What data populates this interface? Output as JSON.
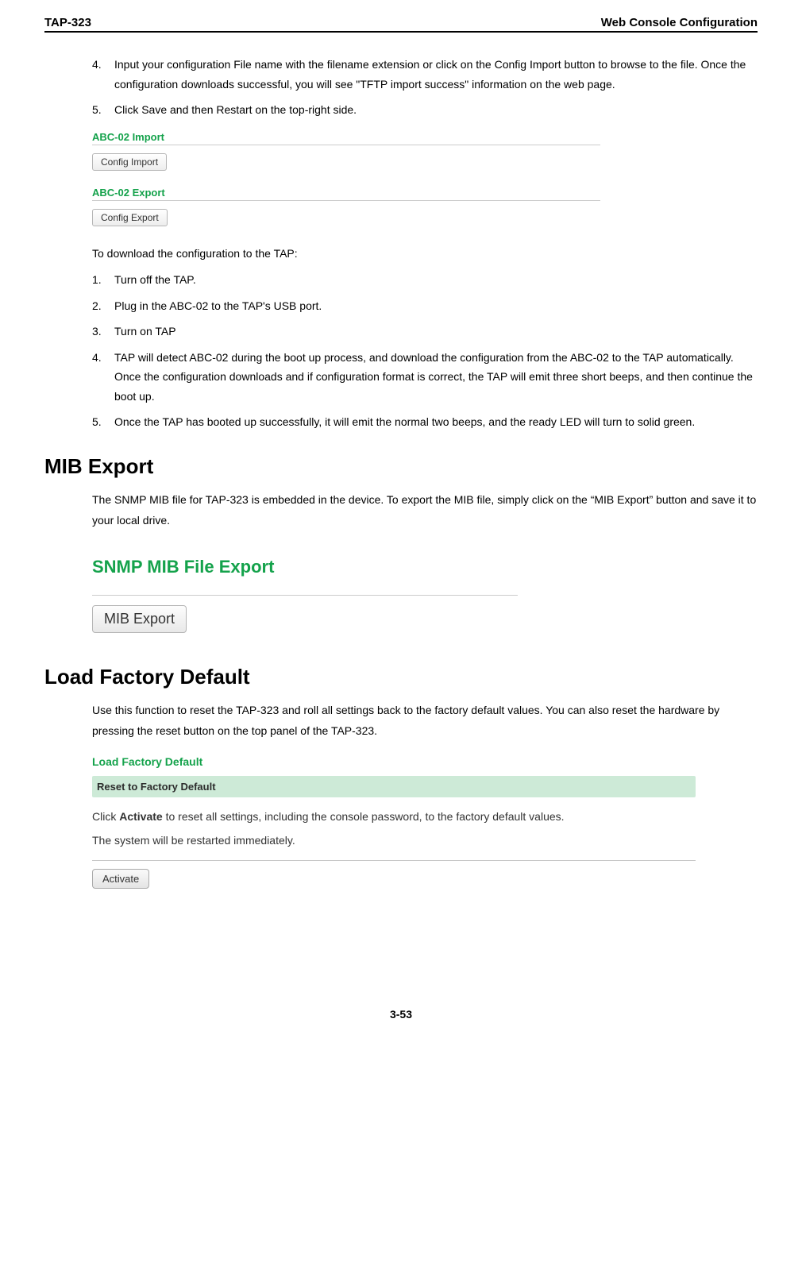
{
  "header": {
    "left": "TAP-323",
    "right": "Web Console Configuration"
  },
  "steps_top": [
    {
      "num": "4.",
      "text": "Input your configuration File name with the filename extension or click on the Config Import button to browse to the file. Once the configuration downloads successful, you will see \"TFTP import success\" information on the web page."
    },
    {
      "num": "5.",
      "text": "Click Save and then Restart on the top-right side."
    }
  ],
  "fig1": {
    "import_title": "ABC-02 Import",
    "import_button": "Config Import",
    "export_title": "ABC-02 Export",
    "export_button": "Config Export"
  },
  "download_intro": "To download the configuration to the TAP:",
  "steps_download": [
    {
      "num": "1.",
      "text": "Turn off the TAP."
    },
    {
      "num": "2.",
      "text": "Plug in the ABC-02 to the TAP's USB port."
    },
    {
      "num": "3.",
      "text": "Turn on TAP"
    },
    {
      "num": "4.",
      "text": "TAP will detect ABC-02 during the boot up process, and download the configuration from the ABC-02 to the TAP automatically. Once the configuration downloads and if configuration format is correct, the TAP will emit three short beeps, and then continue the boot up."
    },
    {
      "num": "5.",
      "text": "Once the TAP has booted up successfully, it will emit the normal two beeps, and the ready LED will turn to solid green."
    }
  ],
  "mib": {
    "heading": "MIB Export",
    "para": "The SNMP MIB file for TAP-323 is embedded in the device. To export the MIB file, simply click on the “MIB Export” button and save it to your local drive.",
    "fig_title": "SNMP MIB File Export",
    "button": "MIB Export"
  },
  "lfd": {
    "heading": "Load Factory Default",
    "para": "Use this function to reset the TAP-323 and roll all settings back to the factory default values. You can also reset the hardware by pressing the reset button on the top panel of the TAP-323.",
    "fig_title": "Load Factory Default",
    "bar": "Reset to Factory Default",
    "line1a": "Click ",
    "line1b": "Activate",
    "line1c": " to reset all settings, including the console password, to the factory default values.",
    "line2": "The system will be restarted immediately.",
    "button": "Activate"
  },
  "footer": "3-53"
}
